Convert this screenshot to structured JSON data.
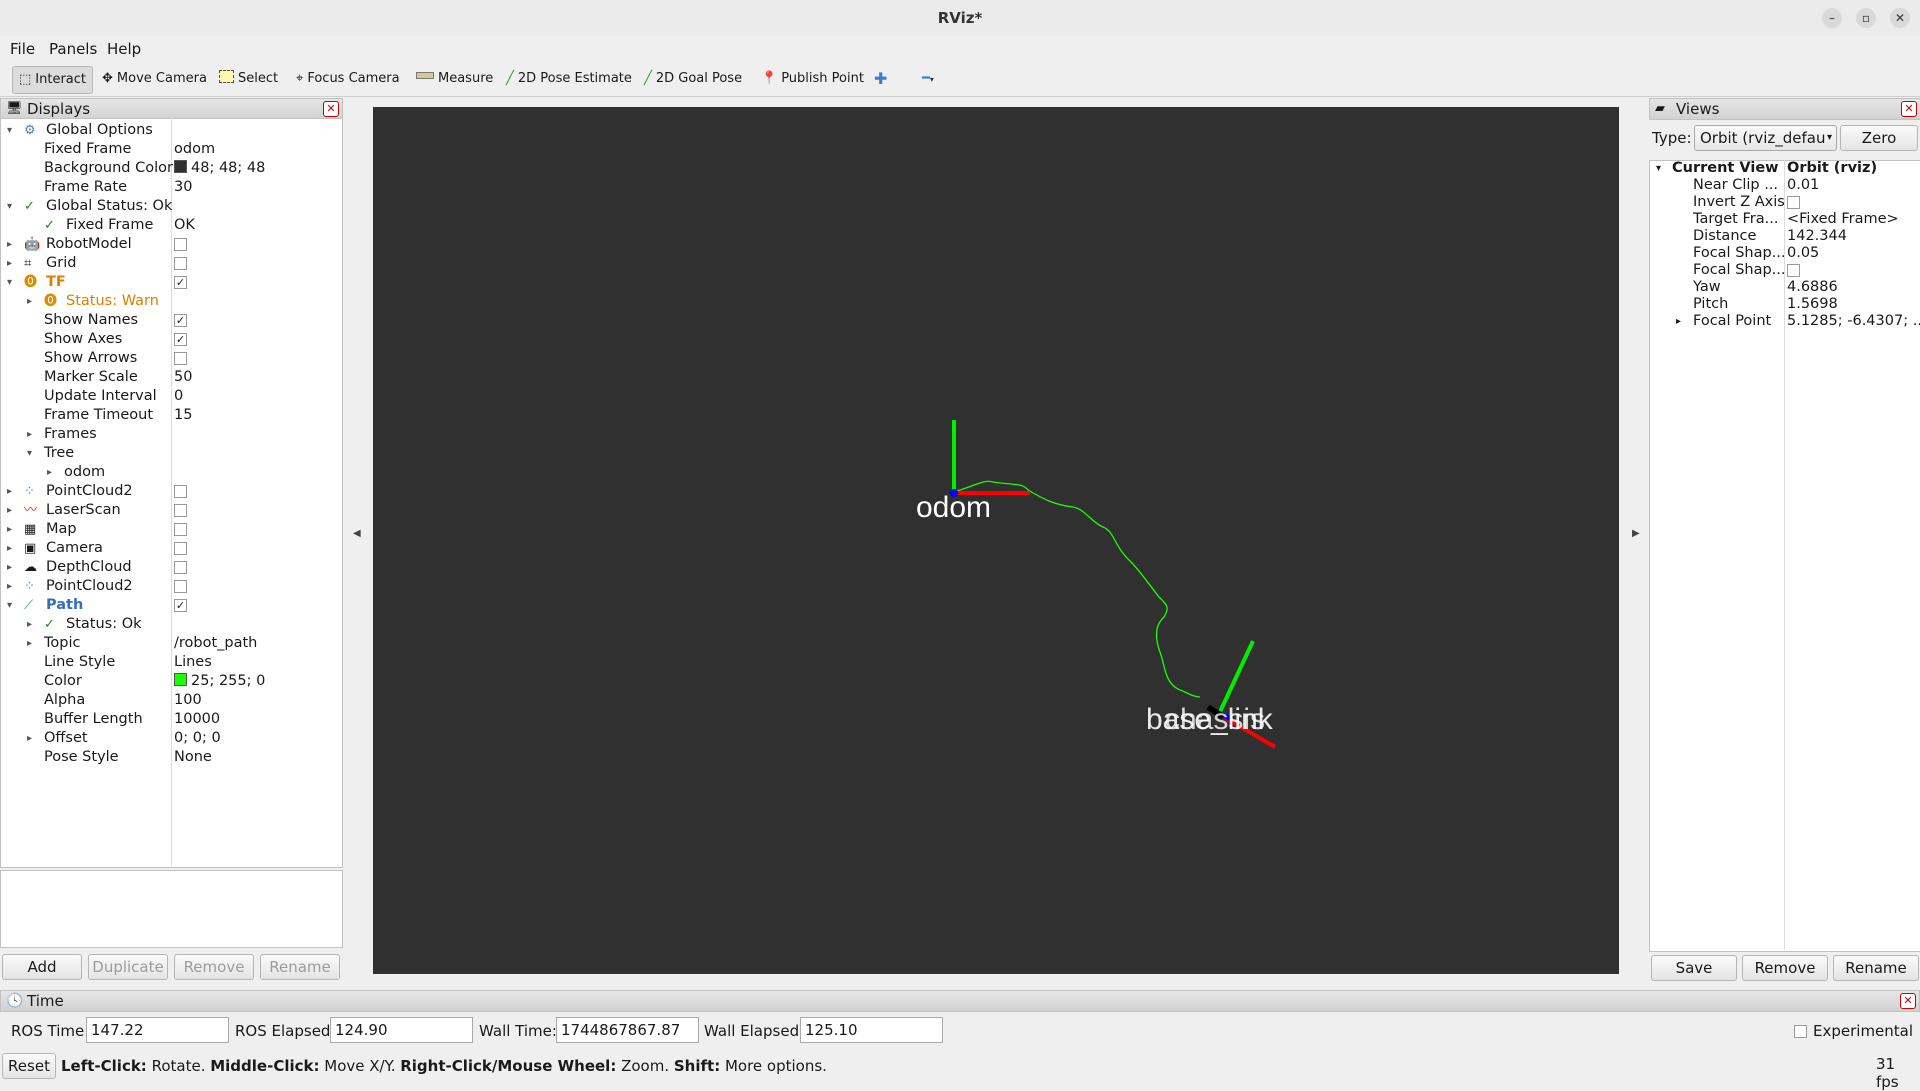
{
  "window": {
    "title": "RViz*"
  },
  "menu": {
    "file": "File",
    "panels": "Panels",
    "help": "Help"
  },
  "toolbar": {
    "interact": "Interact",
    "move_camera": "Move Camera",
    "select": "Select",
    "focus_camera": "Focus Camera",
    "measure": "Measure",
    "pose_estimate": "2D Pose Estimate",
    "goal_pose": "2D Goal Pose",
    "publish_point": "Publish Point"
  },
  "displays": {
    "title": "Displays",
    "rows": [
      {
        "label": "Global Options",
        "value": ""
      },
      {
        "label": "Fixed Frame",
        "value": "odom"
      },
      {
        "label": "Background Color",
        "value": "48; 48; 48"
      },
      {
        "label": "Frame Rate",
        "value": "30"
      },
      {
        "label": "Global Status: Ok",
        "value": ""
      },
      {
        "label": "Fixed Frame",
        "value": "OK"
      },
      {
        "label": "RobotModel",
        "value": ""
      },
      {
        "label": "Grid",
        "value": ""
      },
      {
        "label": "TF",
        "value": ""
      },
      {
        "label": "Status: Warn",
        "value": ""
      },
      {
        "label": "Show Names",
        "value": ""
      },
      {
        "label": "Show Axes",
        "value": ""
      },
      {
        "label": "Show Arrows",
        "value": ""
      },
      {
        "label": "Marker Scale",
        "value": "50"
      },
      {
        "label": "Update Interval",
        "value": "0"
      },
      {
        "label": "Frame Timeout",
        "value": "15"
      },
      {
        "label": "Frames",
        "value": ""
      },
      {
        "label": "Tree",
        "value": ""
      },
      {
        "label": "odom",
        "value": ""
      },
      {
        "label": "PointCloud2",
        "value": ""
      },
      {
        "label": "LaserScan",
        "value": ""
      },
      {
        "label": "Map",
        "value": ""
      },
      {
        "label": "Camera",
        "value": ""
      },
      {
        "label": "DepthCloud",
        "value": ""
      },
      {
        "label": "PointCloud2",
        "value": ""
      },
      {
        "label": "Path",
        "value": ""
      },
      {
        "label": "Status: Ok",
        "value": ""
      },
      {
        "label": "Topic",
        "value": "/robot_path"
      },
      {
        "label": "Line Style",
        "value": "Lines"
      },
      {
        "label": "Color",
        "value": "25; 255; 0"
      },
      {
        "label": "Alpha",
        "value": "100"
      },
      {
        "label": "Buffer Length",
        "value": "10000"
      },
      {
        "label": "Offset",
        "value": "0; 0; 0"
      },
      {
        "label": "Pose Style",
        "value": "None"
      }
    ],
    "buttons": {
      "add": "Add",
      "duplicate": "Duplicate",
      "remove": "Remove",
      "rename": "Rename"
    }
  },
  "viewport": {
    "background_color": "#303030",
    "frame_odom": "odom",
    "frame_base": "base_link",
    "frame_base_overlap": "chassis"
  },
  "views": {
    "title": "Views",
    "type_label": "Type:",
    "type_value": "Orbit (rviz_defau",
    "zero": "Zero",
    "current_view": "Current View",
    "current_view_value": "Orbit (rviz)",
    "props": [
      {
        "label": "Near Clip ...",
        "value": "0.01"
      },
      {
        "label": "Invert Z Axis",
        "value": ""
      },
      {
        "label": "Target Fra...",
        "value": "<Fixed Frame>"
      },
      {
        "label": "Distance",
        "value": "142.344"
      },
      {
        "label": "Focal Shap...",
        "value": "0.05"
      },
      {
        "label": "Focal Shap...",
        "value": ""
      },
      {
        "label": "Yaw",
        "value": "4.6886"
      },
      {
        "label": "Pitch",
        "value": "1.5698"
      },
      {
        "label": "Focal Point",
        "value": "5.1285; -6.4307; ..."
      }
    ],
    "buttons": {
      "save": "Save",
      "remove": "Remove",
      "rename": "Rename"
    }
  },
  "time": {
    "title": "Time",
    "ros_time_label": "ROS Time:",
    "ros_time": "147.22",
    "ros_elapsed_label": "ROS Elapsed:",
    "ros_elapsed": "124.90",
    "wall_time_label": "Wall Time:",
    "wall_time": "1744867867.87",
    "wall_elapsed_label": "Wall Elapsed:",
    "wall_elapsed": "125.10",
    "experimental": "Experimental",
    "reset": "Reset",
    "fps": "31 fps"
  },
  "status": {
    "l1": "Left-Click:",
    "t1": " Rotate. ",
    "l2": "Middle-Click:",
    "t2": " Move X/Y. ",
    "l3": "Right-Click/Mouse Wheel:",
    "t3": " Zoom. ",
    "l4": "Shift:",
    "t4": " More options."
  }
}
